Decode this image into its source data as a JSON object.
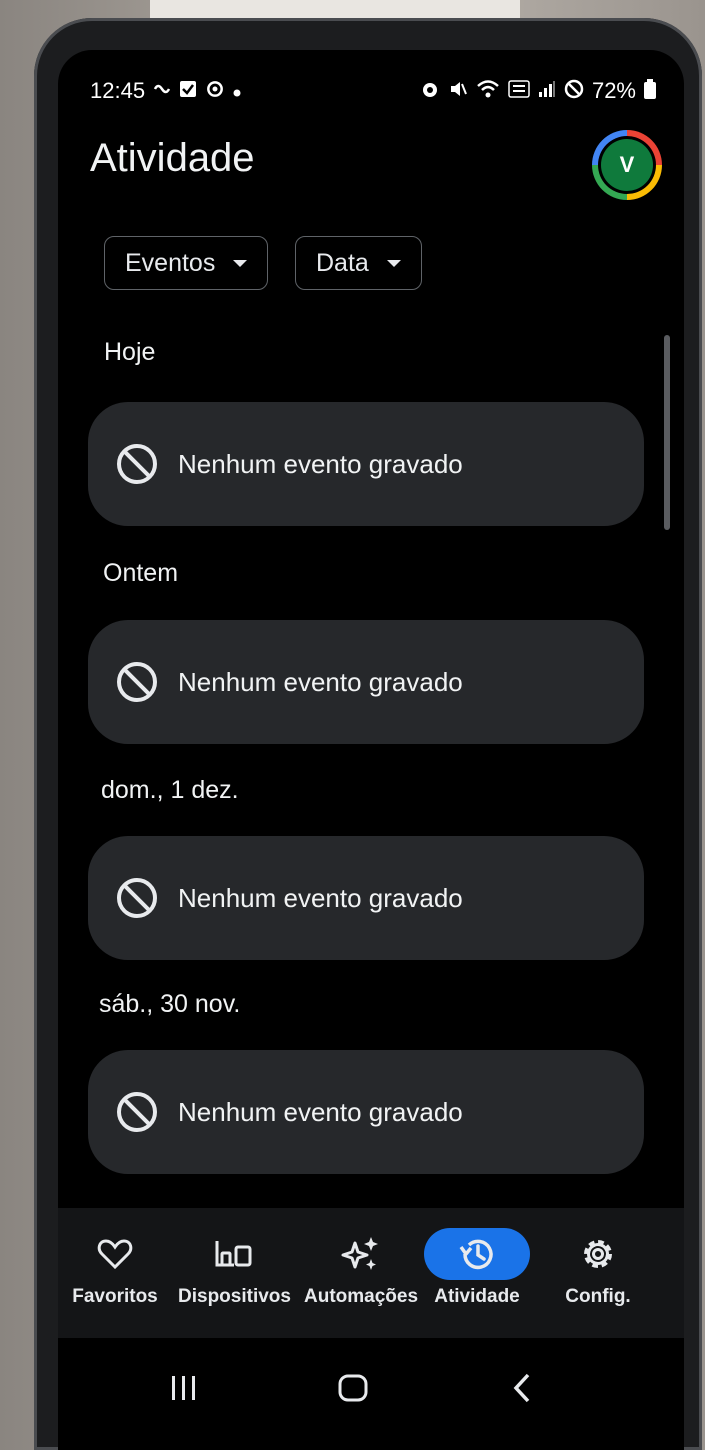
{
  "status_bar": {
    "time": "12:45",
    "battery": "72%"
  },
  "header": {
    "title": "Atividade",
    "avatar_initial": "V"
  },
  "filters": [
    {
      "label": "Eventos"
    },
    {
      "label": "Data"
    }
  ],
  "sections": [
    {
      "label": "Hoje",
      "message": "Nenhum evento gravado"
    },
    {
      "label": "Ontem",
      "message": "Nenhum evento gravado"
    },
    {
      "label": "dom., 1 dez.",
      "message": "Nenhum evento gravado"
    },
    {
      "label": "sáb., 30 nov.",
      "message": "Nenhum evento gravado"
    }
  ],
  "bottom_nav": {
    "items": [
      {
        "label": "Favoritos",
        "icon": "heart-icon"
      },
      {
        "label": "Dispositivos",
        "icon": "devices-icon"
      },
      {
        "label": "Automações",
        "icon": "sparkle-icon"
      },
      {
        "label": "Atividade",
        "icon": "history-icon",
        "active": true
      },
      {
        "label": "Config.",
        "icon": "gear-icon"
      }
    ]
  },
  "colors": {
    "accent": "#1a73e8",
    "card": "#26282b",
    "avatar": "#0f7a3c"
  }
}
